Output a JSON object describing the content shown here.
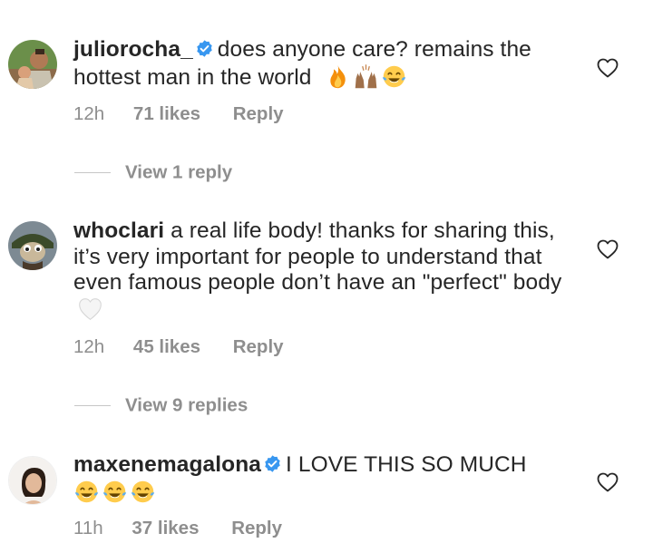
{
  "colors": {
    "text": "#262626",
    "secondary": "#8e8e8e",
    "verified_blue": "#3897f0",
    "divider": "#c7c7c7"
  },
  "comments": [
    {
      "username": "juliorocha_",
      "verified": true,
      "text": "does anyone care?  remains the hottest man in the world",
      "emojis": [
        "fire-emoji",
        "raising-hands-emoji",
        "tears-of-joy-emoji"
      ],
      "time": "12h",
      "likes": "71 likes",
      "reply_label": "Reply",
      "view_replies": "View 1 reply"
    },
    {
      "username": "whoclari",
      "verified": false,
      "text": "a real life body! thanks for sharing this, it’s very important for people to understand that even famous people don’t have an \"perfect\" body",
      "emojis": [
        "white-heart-emoji"
      ],
      "time": "12h",
      "likes": "45 likes",
      "reply_label": "Reply",
      "view_replies": "View 9 replies"
    },
    {
      "username": "maxenemagalona",
      "verified": true,
      "text": "I LOVE THIS SO MUCH",
      "emojis": [
        "tears-of-joy-emoji",
        "tears-of-joy-emoji",
        "tears-of-joy-emoji"
      ],
      "time": "11h",
      "likes": "37 likes",
      "reply_label": "Reply"
    }
  ]
}
